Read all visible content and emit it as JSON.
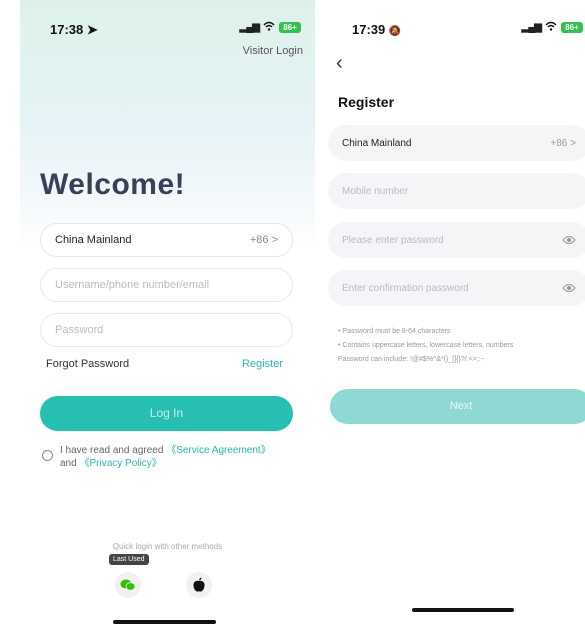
{
  "login": {
    "time": "17:38",
    "battery": "86+",
    "visitor_login": "Visitor Login",
    "welcome": "Welcome!",
    "region": "China Mainland",
    "region_code": "+86 >",
    "username_placeholder": "Username/phone number/email",
    "password_placeholder": "Password",
    "forgot_password": "Forgot Password",
    "register": "Register",
    "login_button": "Log In",
    "agree_prefix": "I have read and agreed",
    "service_agreement": "《Service Agreement》",
    "agree_and": "and",
    "privacy_policy": "《Privacy Policy》",
    "quick_login": "Quick login with other methods",
    "last_used": "Last Used"
  },
  "register": {
    "time": "17:39",
    "battery": "86+",
    "title": "Register",
    "region": "China Mainland",
    "region_code": "+86 >",
    "mobile_placeholder": "Mobile number",
    "password_placeholder": "Please enter password",
    "confirm_placeholder": "Enter confirmation password",
    "rule_1": "• Password must be 8-64 characters",
    "rule_2": "• Contains uppercase letters, lowercase letters, numbers",
    "rule_3": "Password can include: !@#$%^&*()_[]{}?/.<>;:~",
    "next_button": "Next"
  },
  "colors": {
    "accent": "#27bfb2",
    "accent_light": "#8fd9d4",
    "title": "#3b3f5c"
  }
}
